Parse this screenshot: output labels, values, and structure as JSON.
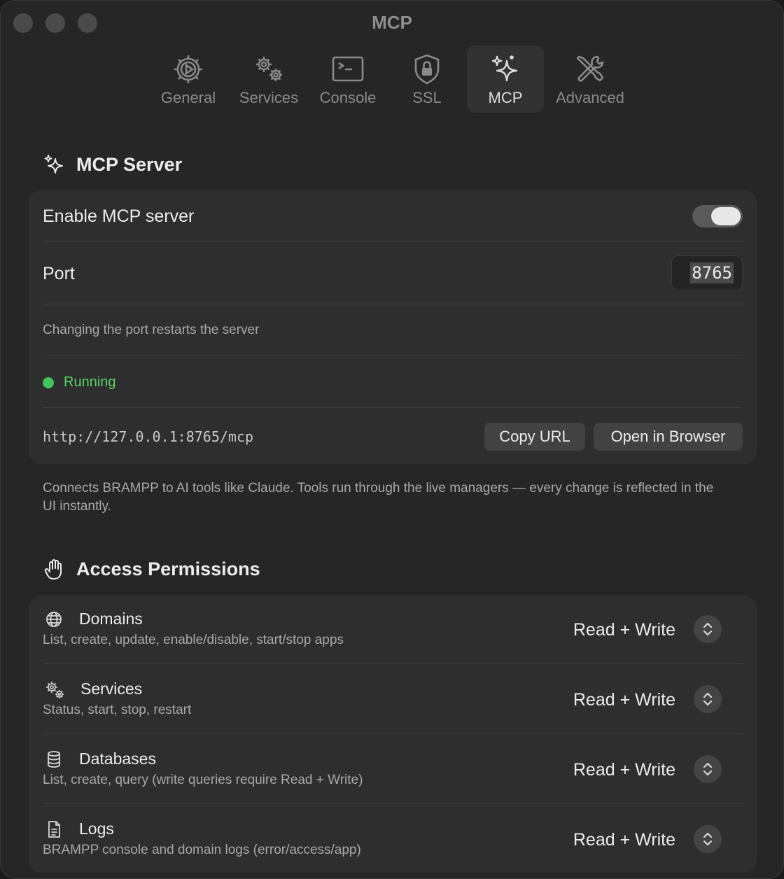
{
  "window": {
    "title": "MCP"
  },
  "toolbar": {
    "tabs": [
      {
        "label": "General",
        "icon": "gear-icon",
        "active": false
      },
      {
        "label": "Services",
        "icon": "gears-icon",
        "active": false
      },
      {
        "label": "Console",
        "icon": "terminal-icon",
        "active": false
      },
      {
        "label": "SSL",
        "icon": "shield-lock-icon",
        "active": false
      },
      {
        "label": "MCP",
        "icon": "sparkles-icon",
        "active": true
      },
      {
        "label": "Advanced",
        "icon": "wrench-screwdriver-icon",
        "active": false
      }
    ]
  },
  "mcp_server": {
    "heading": "MCP Server",
    "heading_icon": "sparkles-icon",
    "enable_label": "Enable MCP server",
    "enabled": true,
    "port_label": "Port",
    "port_value": "8765",
    "port_hint": "Changing the port restarts the server",
    "status": "Running",
    "status_color": "#3fc45a",
    "url": "http://127.0.0.1:8765/mcp",
    "copy_url_label": "Copy URL",
    "open_browser_label": "Open in Browser",
    "note": "Connects BRAMPP to AI tools like Claude. Tools run through the live managers — every change is reflected in the UI instantly."
  },
  "access": {
    "heading": "Access Permissions",
    "heading_icon": "hand-icon",
    "items": [
      {
        "title": "Domains",
        "icon": "globe-icon",
        "description": "List, create, update, enable/disable, start/stop apps",
        "value": "Read + Write"
      },
      {
        "title": "Services",
        "icon": "gears-icon",
        "description": "Status, start, stop, restart",
        "value": "Read + Write"
      },
      {
        "title": "Databases",
        "icon": "database-icon",
        "description": "List, create, query (write queries require Read + Write)",
        "value": "Read + Write"
      },
      {
        "title": "Logs",
        "icon": "document-icon",
        "description": "BRAMPP console and domain logs (error/access/app)",
        "value": "Read + Write"
      }
    ]
  }
}
